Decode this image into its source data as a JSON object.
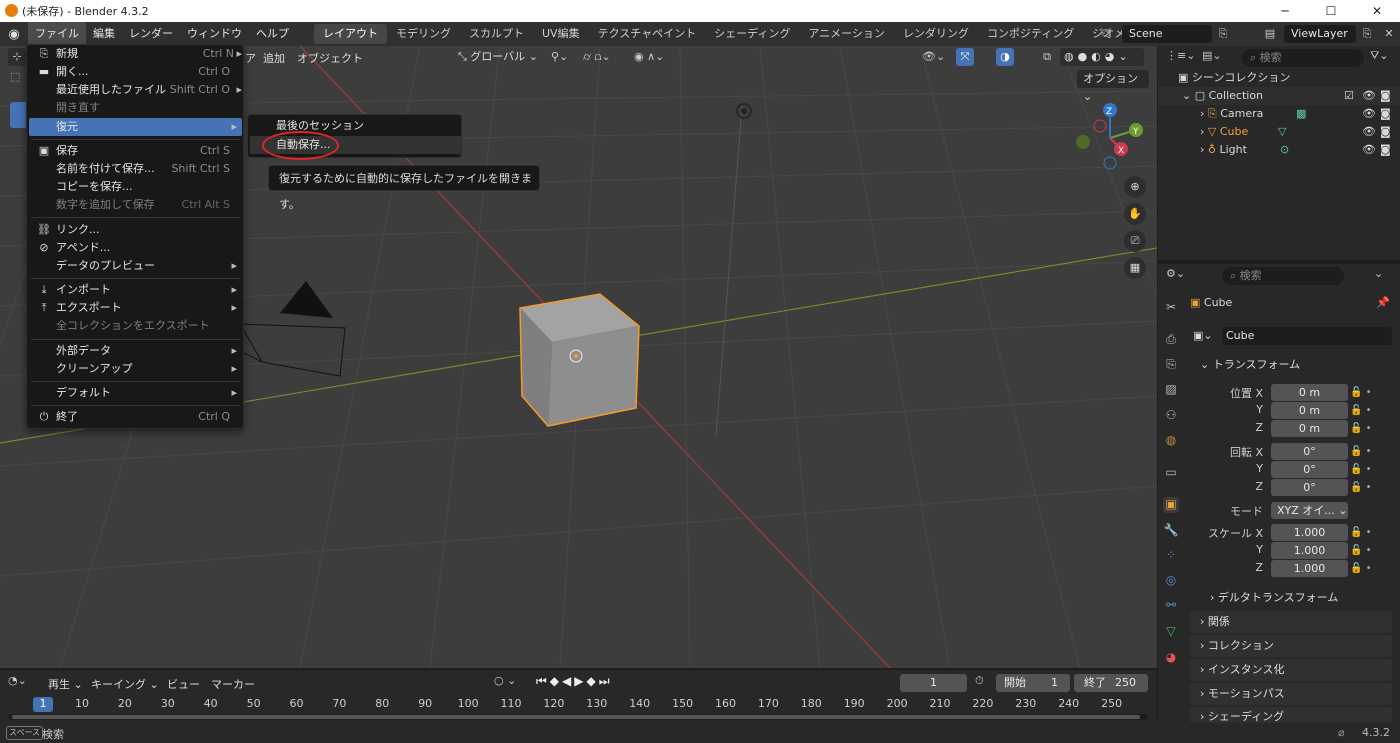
{
  "window": {
    "title": "(未保存) - Blender 4.3.2",
    "minimize": "─",
    "maximize": "☐",
    "close": "✕"
  },
  "menubar": [
    "ファイル",
    "編集",
    "レンダー",
    "ウィンドウ",
    "ヘルプ"
  ],
  "workspaces": [
    "レイアウト",
    "モデリング",
    "スカルプト",
    "UV編集",
    "テクスチャペイント",
    "シェーディング",
    "アニメーション",
    "レンダリング",
    "コンポジティング",
    "ジオメトリ"
  ],
  "scene": "Scene",
  "viewlayer": "ViewLayer",
  "viewport_header": {
    "add": "追加",
    "object": "オブジェクト",
    "transform": "グローバル",
    "options": "オプション"
  },
  "file_menu": [
    {
      "label": "新規",
      "shortcut": "Ctrl N",
      "arrow": "▸",
      "icon": "⎘",
      "disabled": false
    },
    {
      "label": "開く...",
      "shortcut": "Ctrl O",
      "arrow": "",
      "icon": "▬",
      "disabled": false
    },
    {
      "label": "最近使用したファイル",
      "shortcut": "Shift Ctrl O",
      "arrow": "▸",
      "icon": "",
      "disabled": false
    },
    {
      "label": "開き直す",
      "shortcut": "",
      "arrow": "",
      "icon": "",
      "disabled": true
    },
    {
      "label": "復元",
      "shortcut": "",
      "arrow": "▸",
      "icon": "",
      "disabled": false
    },
    {
      "label": "保存",
      "shortcut": "Ctrl S",
      "arrow": "",
      "icon": "▣",
      "disabled": false
    },
    {
      "label": "名前を付けて保存...",
      "shortcut": "Shift Ctrl S",
      "arrow": "",
      "icon": "",
      "disabled": false
    },
    {
      "label": "コピーを保存...",
      "shortcut": "",
      "arrow": "",
      "icon": "",
      "disabled": false
    },
    {
      "label": "数字を追加して保存",
      "shortcut": "Ctrl Alt S",
      "arrow": "",
      "icon": "",
      "disabled": true
    },
    {
      "label": "リンク...",
      "shortcut": "",
      "arrow": "",
      "icon": "⛓",
      "disabled": false
    },
    {
      "label": "アペンド...",
      "shortcut": "",
      "arrow": "",
      "icon": "⊘",
      "disabled": false
    },
    {
      "label": "データのプレビュー",
      "shortcut": "",
      "arrow": "▸",
      "icon": "",
      "disabled": false
    },
    {
      "label": "インポート",
      "shortcut": "",
      "arrow": "▸",
      "icon": "⤓",
      "disabled": false
    },
    {
      "label": "エクスポート",
      "shortcut": "",
      "arrow": "▸",
      "icon": "⤒",
      "disabled": false
    },
    {
      "label": "全コレクションをエクスポート",
      "shortcut": "",
      "arrow": "",
      "icon": "",
      "disabled": true
    },
    {
      "label": "外部データ",
      "shortcut": "",
      "arrow": "▸",
      "icon": "",
      "disabled": false
    },
    {
      "label": "クリーンアップ",
      "shortcut": "",
      "arrow": "▸",
      "icon": "",
      "disabled": false
    },
    {
      "label": "デフォルト",
      "shortcut": "",
      "arrow": "▸",
      "icon": "",
      "disabled": false
    },
    {
      "label": "終了",
      "shortcut": "Ctrl Q",
      "arrow": "",
      "icon": "⏻",
      "disabled": false
    }
  ],
  "recover_submenu": [
    "最後のセッション",
    "自動保存..."
  ],
  "tooltip": "復元するために自動的に保存したファイルを開きます。",
  "outliner": {
    "search": "検索",
    "root": "シーンコレクション",
    "collection": "Collection",
    "items": [
      "Camera",
      "Cube",
      "Light"
    ]
  },
  "properties": {
    "search": "検索",
    "object": "Cube",
    "name": "Cube",
    "transform": "トランスフォーム",
    "loc_label": "位置 X",
    "rot_label": "回転 X",
    "scale_label": "スケール X",
    "y": "Y",
    "z": "Z",
    "loc": [
      "0 m",
      "0 m",
      "0 m"
    ],
    "rot": [
      "0°",
      "0°",
      "0°"
    ],
    "scale": [
      "1.000",
      "1.000",
      "1.000"
    ],
    "mode_label": "モード",
    "mode": "XYZ オイ...",
    "delta": "デルタトランスフォーム",
    "panels": [
      "関係",
      "コレクション",
      "インスタンス化",
      "モーションパス",
      "シェーディング"
    ]
  },
  "timeline": {
    "play": "再生",
    "keying": "キーイング",
    "view": "ビュー",
    "marker": "マーカー",
    "current": "1",
    "start_label": "開始",
    "start": "1",
    "end_label": "終了",
    "end": "250",
    "ticks": [
      "1",
      "10",
      "20",
      "30",
      "40",
      "50",
      "60",
      "70",
      "80",
      "90",
      "100",
      "110",
      "120",
      "130",
      "140",
      "150",
      "160",
      "170",
      "180",
      "190",
      "200",
      "210",
      "220",
      "230",
      "240",
      "250"
    ]
  },
  "status": {
    "key": "スペース",
    "action": "検索",
    "version": "4.3.2"
  }
}
